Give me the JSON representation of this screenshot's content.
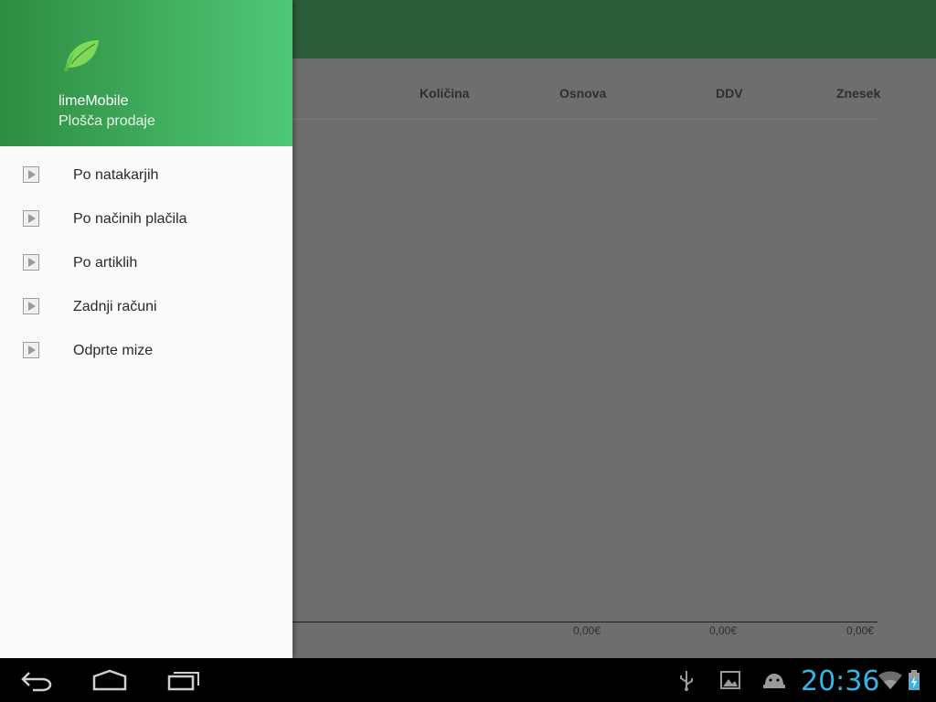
{
  "drawer": {
    "app_name": "limeMobile",
    "subtitle": "Plošča prodaje",
    "items": [
      {
        "label": "Po natakarjih"
      },
      {
        "label": "Po načinih plačila"
      },
      {
        "label": "Po artiklih"
      },
      {
        "label": "Zadnji računi"
      },
      {
        "label": "Odprte mize"
      }
    ]
  },
  "table": {
    "columns": [
      "Količina",
      "Osnova",
      "DDV",
      "Znesek"
    ],
    "totals": [
      "0,00€",
      "0,00€",
      "0,00€"
    ]
  },
  "status_bar": {
    "time": "20:36",
    "icons": [
      "usb-icon",
      "gallery-icon",
      "android-debug-icon",
      "wifi-icon",
      "battery-charging-icon"
    ]
  },
  "navigation": {
    "buttons": [
      "back-icon",
      "home-icon",
      "recent-apps-icon"
    ]
  },
  "colors": {
    "header_gradient_start": "#2e8c3f",
    "header_gradient_end": "#4fc877",
    "toolbar": "#2b5c39",
    "clock": "#33b5e5"
  }
}
